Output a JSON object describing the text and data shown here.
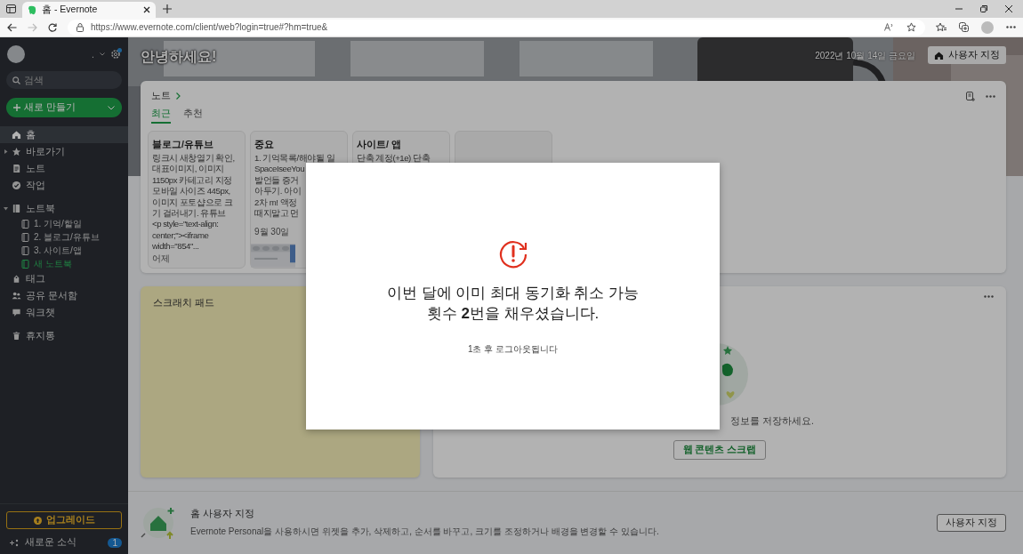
{
  "browser": {
    "tab_title": "홈 - Evernote",
    "url": "https://www.evernote.com/client/web?login=true#?hm=true&"
  },
  "sidebar": {
    "account_name": ".",
    "search": {
      "placeholder": "검색"
    },
    "new_button": "새로 만들기",
    "sections": [
      {
        "items": [
          {
            "label": "홈",
            "selected": true
          },
          {
            "label": "바로가기",
            "selected": false,
            "expanded": false
          },
          {
            "label": "노트",
            "selected": false
          },
          {
            "label": "작업",
            "selected": false
          }
        ]
      },
      {
        "items": [
          {
            "label": "노트북",
            "selected": false,
            "expanded": true,
            "children": [
              {
                "label": "1. 기억/할일",
                "kind": "notebook"
              },
              {
                "label": "2. 블로그/유튜브",
                "kind": "notebook"
              },
              {
                "label": "3. 사이트/앱",
                "kind": "notebook"
              },
              {
                "label": "새 노트북",
                "kind": "action"
              }
            ]
          },
          {
            "label": "태그",
            "selected": false
          },
          {
            "label": "공유 문서함",
            "selected": false
          },
          {
            "label": "워크챗",
            "selected": false
          }
        ]
      },
      {
        "items": [
          {
            "label": "휴지통",
            "selected": false
          }
        ]
      }
    ],
    "upgrade_button": "업그레이드",
    "news": {
      "label": "새로운 소식",
      "badge": "1"
    }
  },
  "header": {
    "greeting": "안녕하세요!",
    "date": "2022년 10월 14일 금요일",
    "customize_button": "사용자 지정"
  },
  "notes_widget": {
    "title": "노트",
    "tabs": [
      {
        "label": "최근",
        "selected": true
      },
      {
        "label": "추천",
        "selected": false
      }
    ],
    "cards": [
      {
        "kind": "note",
        "title": "블로그/유튜브",
        "lines": [
          "링크시 새창열기 확인,",
          "대표이미지, 이미지",
          "1150px 카테고리 지정",
          "모바일 사이즈 445px,",
          "이미지 포토샵으로 크",
          "기 걸러내기. 유튜브",
          "<p style=\"text-align:",
          "center;\"><iframe",
          "width=\"854\"..."
        ],
        "date": "어제",
        "has_thumbnail": false
      },
      {
        "kind": "note",
        "title": "중요",
        "lines": [
          "1. 기억목록/해야될 일",
          "SpaceIseeYou",
          "발언들 증거",
          "아두기. 아이",
          "2차 m! 액정",
          "때지말고 먼"
        ],
        "date": "9월 30일",
        "has_thumbnail": true
      },
      {
        "kind": "note",
        "title": "사이트/ 앱",
        "lines": [
          "단축 계정(+1e) 단축"
        ]
      },
      {
        "kind": "empty"
      }
    ]
  },
  "scratch_pad": {
    "title": "스크래치 패드"
  },
  "clip_widget": {
    "text": "정보를 저장하세요.",
    "button": "웹 콘텐츠 스크랩"
  },
  "customize_bar": {
    "title": "홈 사용자 지정",
    "description": "Evernote Personal을 사용하시면 위젯을 추가, 삭제하고, 순서를 바꾸고, 크기를 조정하거나 배경을 변경할 수 있습니다.",
    "button": "사용자 지정"
  },
  "dialog": {
    "message_lines": [
      "이번 달에 이미 최대 동기화 취소 가능",
      "횟수 **2**번을 채우셨습니다."
    ],
    "note": "1초 후 로그아웃됩니다"
  }
}
